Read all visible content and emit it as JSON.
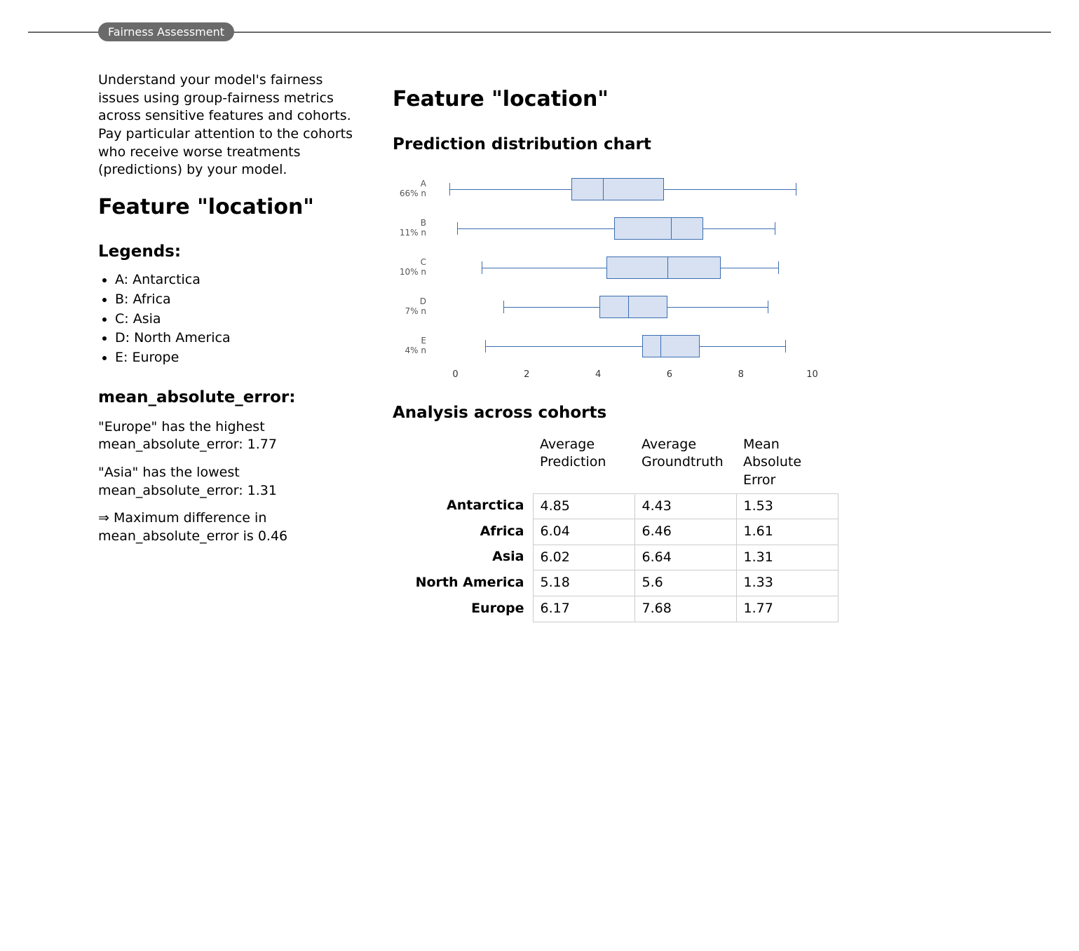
{
  "section": {
    "label": "Fairness Assessment"
  },
  "intro": "Understand your model's fairness issues using group-fairness metrics across sensitive features and cohorts. Pay particular attention to the cohorts who receive worse treatments (predictions) by your model.",
  "left": {
    "title": "Feature \"location\"",
    "legends_heading": "Legends:",
    "legends": [
      "A: Antarctica",
      "B: Africa",
      "C: Asia",
      "D: North America",
      "E: Europe"
    ],
    "metric_heading": "mean_absolute_error:",
    "highest": "\"Europe\" has the highest mean_absolute_error: 1.77",
    "lowest": "\"Asia\" has the lowest mean_absolute_error: 1.31",
    "maxdiff": "⇒ Maximum difference in mean_absolute_error is 0.46"
  },
  "right": {
    "title": "Feature \"location\"",
    "chart_heading": "Prediction distribution chart",
    "table_heading": "Analysis across cohorts"
  },
  "table": {
    "columns": [
      "",
      "Average Prediction",
      "Average Groundtruth",
      "Mean Absolute Error"
    ],
    "rows": [
      {
        "name": "Antarctica",
        "avg_pred": "4.85",
        "avg_gt": "4.43",
        "mae": "1.53"
      },
      {
        "name": "Africa",
        "avg_pred": "6.04",
        "avg_gt": "6.46",
        "mae": "1.61"
      },
      {
        "name": "Asia",
        "avg_pred": "6.02",
        "avg_gt": "6.64",
        "mae": "1.31"
      },
      {
        "name": "North America",
        "avg_pred": "5.18",
        "avg_gt": "5.6",
        "mae": "1.33"
      },
      {
        "name": "Europe",
        "avg_pred": "6.17",
        "avg_gt": "7.68",
        "mae": "1.77"
      }
    ]
  },
  "chart_data": {
    "type": "boxplot",
    "title": "Prediction distribution chart",
    "xlabel": "",
    "ylabel": "",
    "xlim": [
      -0.5,
      10.5
    ],
    "xticks": [
      0,
      2,
      4,
      6,
      8,
      10
    ],
    "series": [
      {
        "code": "A",
        "pct": "66% n",
        "min": 0.0,
        "q1": 3.4,
        "median": 4.3,
        "q3": 6.0,
        "max": 9.7
      },
      {
        "code": "B",
        "pct": "11% n",
        "min": 0.2,
        "q1": 4.6,
        "median": 6.2,
        "q3": 7.1,
        "max": 9.1
      },
      {
        "code": "C",
        "pct": "10% n",
        "min": 0.9,
        "q1": 4.4,
        "median": 6.1,
        "q3": 7.6,
        "max": 9.2
      },
      {
        "code": "D",
        "pct": "7% n",
        "min": 1.5,
        "q1": 4.2,
        "median": 5.0,
        "q3": 6.1,
        "max": 8.9
      },
      {
        "code": "E",
        "pct": "4% n",
        "min": 1.0,
        "q1": 5.4,
        "median": 5.9,
        "q3": 7.0,
        "max": 9.4
      }
    ]
  }
}
